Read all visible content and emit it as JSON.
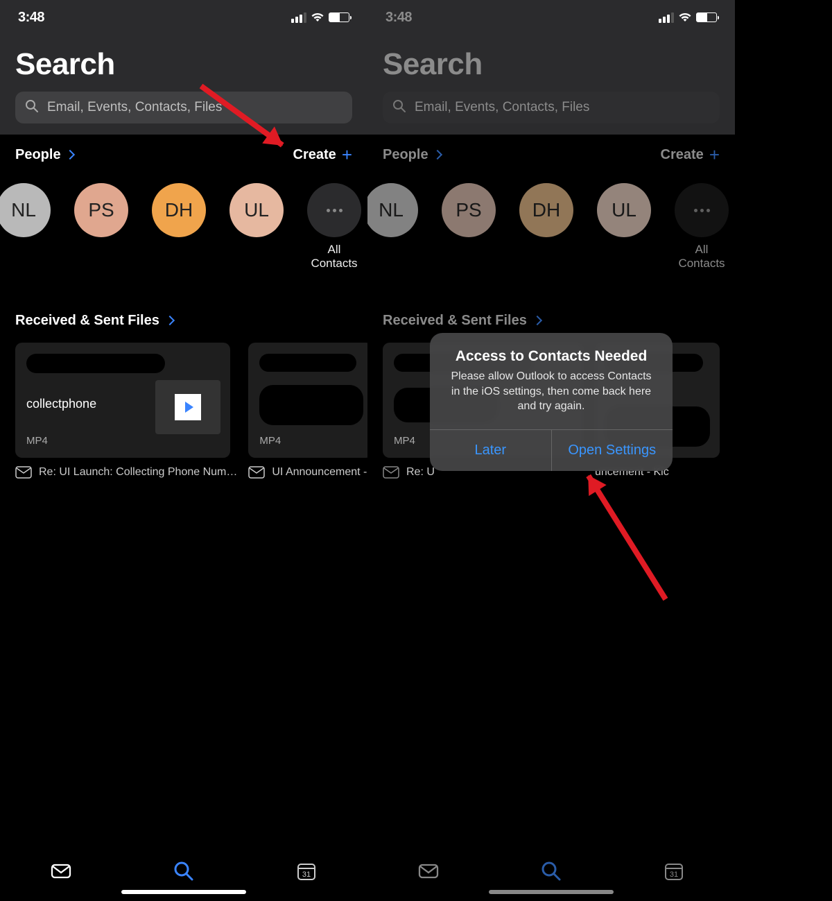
{
  "status": {
    "time": "3:48"
  },
  "title": "Search",
  "search": {
    "placeholder": "Email, Events, Contacts, Files"
  },
  "people": {
    "label": "People",
    "create_label": "Create",
    "all_contacts": "All\nContacts",
    "contacts": [
      {
        "initials": "NL",
        "color": "c-nl"
      },
      {
        "initials": "PS",
        "color": "c-ps"
      },
      {
        "initials": "DH",
        "color": "c-dh"
      },
      {
        "initials": "UL",
        "color": "c-ul"
      }
    ]
  },
  "files": {
    "label": "Received & Sent Files",
    "items": [
      {
        "name": "collectphone",
        "ext": "MP4",
        "sub": "Re: UI Launch: Collecting Phone Num…"
      },
      {
        "name": "",
        "ext": "MP4",
        "sub": "UI Announcement - Kic"
      }
    ],
    "items_right": [
      {
        "ext": "MP4",
        "sub": "Re: U"
      },
      {
        "sub": "uncement - Kic"
      }
    ]
  },
  "alert": {
    "title": "Access to Contacts Needed",
    "body": "Please allow Outlook to access Contacts in the iOS settings, then come back here and try again.",
    "later": "Later",
    "open": "Open Settings"
  },
  "tabs": {
    "calendar_day": "31"
  }
}
